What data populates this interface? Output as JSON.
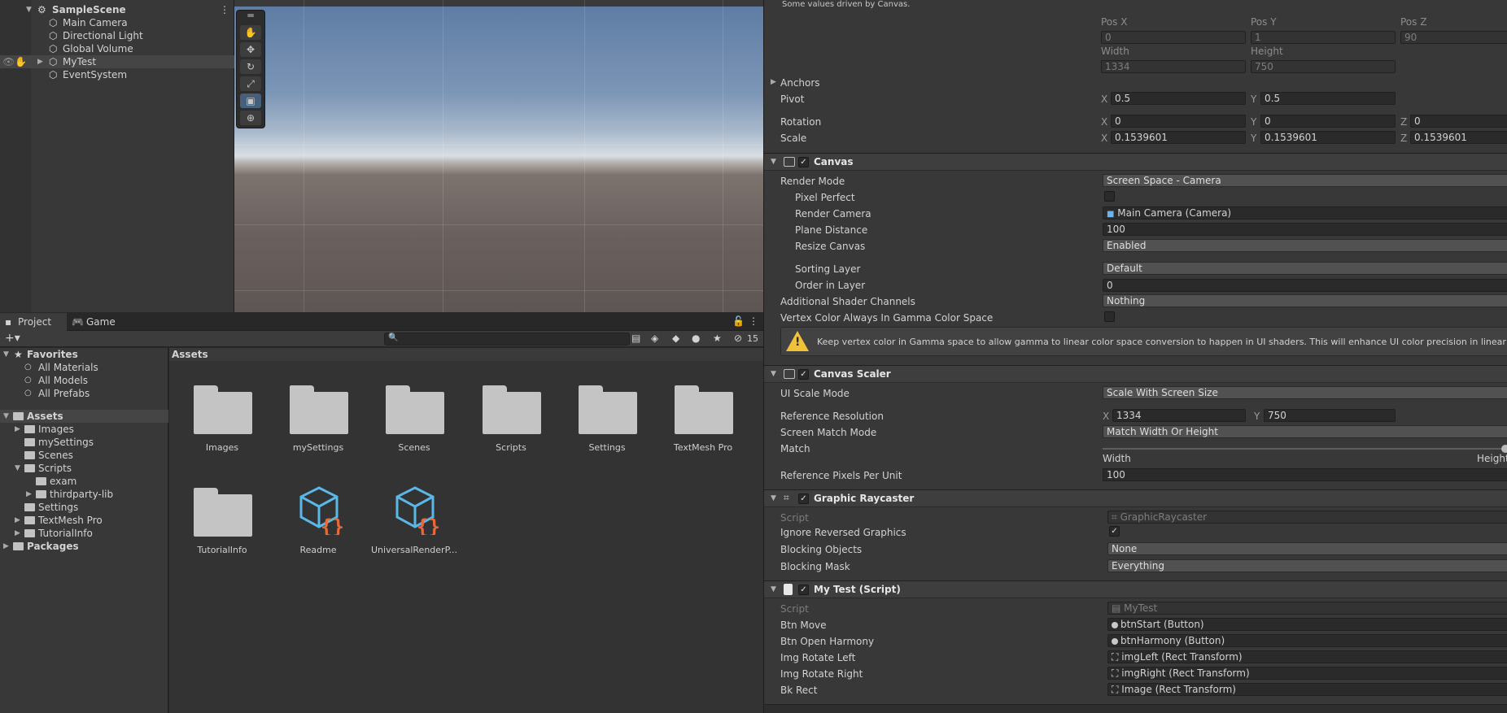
{
  "hierarchy": {
    "scene": "SampleScene",
    "items": [
      "Main Camera",
      "Directional Light",
      "Global Volume",
      "MyTest",
      "EventSystem"
    ]
  },
  "project": {
    "tabs": [
      "Project",
      "Game"
    ],
    "badge_count": "15",
    "tree": {
      "favorites": "Favorites",
      "fav_items": [
        "All Materials",
        "All Models",
        "All Prefabs"
      ],
      "assets": "Assets",
      "asset_items": [
        "Images",
        "mySettings",
        "Scenes",
        "Scripts",
        "exam",
        "thirdparty-lib",
        "Settings",
        "TextMesh Pro",
        "TutorialInfo"
      ],
      "packages": "Packages"
    },
    "grid_title": "Assets",
    "grid_items": [
      "Images",
      "mySettings",
      "Scenes",
      "Scripts",
      "Settings",
      "TextMesh Pro",
      "TutorialInfo",
      "Readme",
      "UniversalRenderP..."
    ]
  },
  "inspector": {
    "driven_note": "Some values driven by Canvas.",
    "rect": {
      "posx_label": "Pos X",
      "posy_label": "Pos Y",
      "posz_label": "Pos Z",
      "posx": "0",
      "posy": "1",
      "posz": "90",
      "width_label": "Width",
      "height_label": "Height",
      "width": "1334",
      "height": "750",
      "anchors": "Anchors",
      "pivot": "Pivot",
      "pivot_x": "0.5",
      "pivot_y": "0.5",
      "rotation": "Rotation",
      "rot_x": "0",
      "rot_y": "0",
      "rot_z": "0",
      "scale": "Scale",
      "scale_x": "0.1539601",
      "scale_y": "0.1539601",
      "scale_z": "0.1539601"
    },
    "axes": {
      "x": "X",
      "y": "Y",
      "z": "Z"
    },
    "canvas": {
      "title": "Canvas",
      "render_mode": "Render Mode",
      "render_mode_val": "Screen Space - Camera",
      "pixel_perfect": "Pixel Perfect",
      "render_camera": "Render Camera",
      "render_camera_val": "Main Camera (Camera)",
      "plane_distance": "Plane Distance",
      "plane_distance_val": "100",
      "resize_canvas": "Resize Canvas",
      "resize_canvas_val": "Enabled",
      "sorting_layer": "Sorting Layer",
      "sorting_layer_val": "Default",
      "order_in_layer": "Order in Layer",
      "order_in_layer_val": "0",
      "shader_channels": "Additional Shader Channels",
      "shader_channels_val": "Nothing",
      "vertex_color": "Vertex Color Always In Gamma Color Space",
      "warning": "Keep vertex color in Gamma space to allow gamma to linear color space conversion to happen in UI shaders. This will enhance UI color precision in linear color space."
    },
    "scaler": {
      "title": "Canvas Scaler",
      "ui_scale_mode": "UI Scale Mode",
      "ui_scale_mode_val": "Scale With Screen Size",
      "ref_res": "Reference Resolution",
      "ref_x": "1334",
      "ref_y": "750",
      "match_mode": "Screen Match Mode",
      "match_mode_val": "Match Width Or Height",
      "match": "Match",
      "match_width": "Width",
      "match_height": "Height",
      "match_value": 1.0,
      "ref_ppu": "Reference Pixels Per Unit",
      "ref_ppu_val": "100"
    },
    "raycaster": {
      "title": "Graphic Raycaster",
      "script": "Script",
      "script_val": "GraphicRaycaster",
      "ignore_reversed": "Ignore Reversed Graphics",
      "blocking_objects": "Blocking Objects",
      "blocking_objects_val": "None",
      "blocking_mask": "Blocking Mask",
      "blocking_mask_val": "Everything"
    },
    "mytest": {
      "title": "My Test (Script)",
      "script": "Script",
      "script_val": "MyTest",
      "btn_move": "Btn Move",
      "btn_move_val": "btnStart (Button)",
      "btn_harmony": "Btn Open Harmony",
      "btn_harmony_val": "btnHarmony (Button)",
      "img_left": "Img Rotate Left",
      "img_left_val": "imgLeft (Rect Transform)",
      "img_right": "Img Rotate Right",
      "img_right_val": "imgRight (Rect Transform)",
      "bk_rect": "Bk Rect",
      "bk_rect_val": "Image (Rect Transform)"
    }
  },
  "colors": {
    "selection": "#454545",
    "accent": "#46607c",
    "warning": "#f0c23a",
    "script_icon": "#5ab7e8"
  }
}
